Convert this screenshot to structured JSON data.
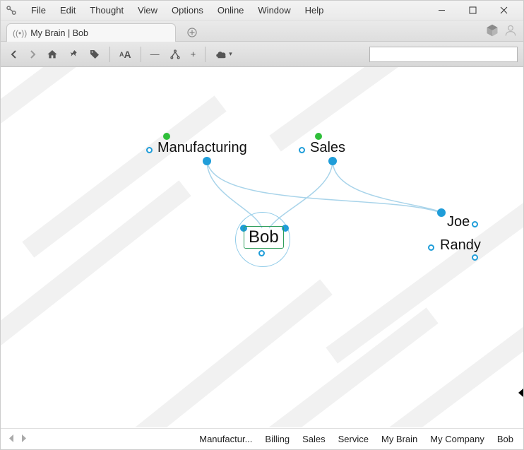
{
  "menu": {
    "items": [
      "File",
      "Edit",
      "Thought",
      "View",
      "Options",
      "Online",
      "Window",
      "Help"
    ]
  },
  "tab": {
    "title": "My Brain | Bob"
  },
  "search": {
    "placeholder": ""
  },
  "nodes": {
    "manufacturing": "Manufacturing",
    "sales": "Sales",
    "bob": "Bob",
    "joe": "Joe",
    "randy": "Randy"
  },
  "history": {
    "items": [
      "Manufactur...",
      "Billing",
      "Sales",
      "Service",
      "My Brain",
      "My Company",
      "Bob"
    ]
  },
  "colors": {
    "link": "#a9d4ea",
    "node_blue": "#1f9dd9",
    "node_green": "#2fbf3a",
    "active_border": "#2e9e5b"
  }
}
